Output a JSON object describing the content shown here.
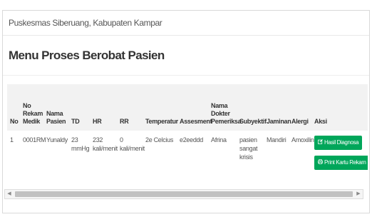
{
  "header": {
    "breadcrumb": "Puskesmas Siberuang, Kabupaten Kampar"
  },
  "page": {
    "title": "Menu Proses Berobat Pasien"
  },
  "table": {
    "headers": {
      "no": "No",
      "no_rm": [
        "No",
        "Rekam",
        "Medik"
      ],
      "nama_pasien": [
        "Nama",
        "Pasien"
      ],
      "td": "TD",
      "hr": "HR",
      "rr": "RR",
      "temperatur": "Temperatur",
      "assesment": "Assesment",
      "dokter": [
        "Nama",
        "Dokter",
        "Pemeriksa"
      ],
      "subyektif": "Subyektif",
      "jaminan": "Jaminan",
      "alergi": "Alergi",
      "aksi": "Aksi"
    },
    "rows": [
      {
        "no": "1",
        "no_rm": "0001RM",
        "nama_pasien": "Yunaldy",
        "td": [
          "23",
          "mmHg"
        ],
        "hr": [
          "232",
          "kali/menit"
        ],
        "rr": [
          "0",
          "kali/menit"
        ],
        "temperatur": "2e Celcius",
        "assesment": "e2eeddd",
        "dokter": "Afrina",
        "subyektif": [
          "pasien",
          "sangat",
          "krisis"
        ],
        "jaminan": "Mandiri",
        "alergi": "Amoxilin",
        "btn_diagnosa": "Hasil Diagnosa",
        "btn_print": "Print Kartu Rekam Medik"
      }
    ]
  },
  "icons": {
    "edit": "edit-icon",
    "print": "print-icon",
    "scroll_left": "scroll-left-arrow-icon",
    "scroll_right": "scroll-right-arrow-icon"
  },
  "colors": {
    "button_green": "#00a65a",
    "header_bg": "#f2f2f2",
    "border": "#d9d9d9"
  }
}
